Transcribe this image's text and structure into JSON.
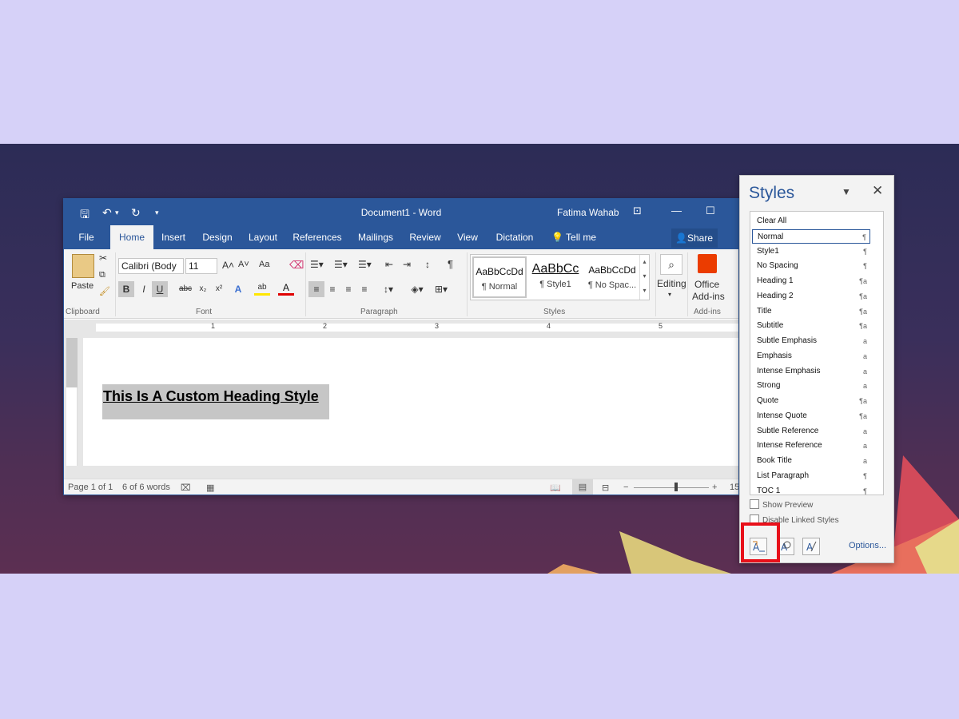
{
  "colors": {
    "accent": "#2b579a",
    "highlight_red": "#e8101a"
  },
  "word": {
    "title_doc": "Document1",
    "title_sep": "-",
    "title_app": "Word",
    "user": "Fatima Wahab",
    "tabs": [
      "File",
      "Home",
      "Insert",
      "Design",
      "Layout",
      "References",
      "Mailings",
      "Review",
      "View",
      "Dictation"
    ],
    "tell_me": "Tell me",
    "share": "Share",
    "ribbon": {
      "paste": "Paste",
      "font_name": "Calibri (Body",
      "font_size": "11",
      "aa": "Aa",
      "bold": "B",
      "italic": "I",
      "underline": "U",
      "strike": "abc",
      "sub": "x₂",
      "sup": "x²",
      "pilcrow": "¶",
      "style_samples": [
        "AaBbCcDd",
        "AaBbCc",
        "AaBbCcDd"
      ],
      "style_names": [
        "¶ Normal",
        "¶ Style1",
        "¶ No Spac..."
      ],
      "editing": "Editing",
      "office": "Office",
      "addins": "Add-ins",
      "groups": [
        "Clipboard",
        "Font",
        "Paragraph",
        "Styles",
        "Add-ins"
      ]
    },
    "ruler_numbers": [
      "1",
      "2",
      "3",
      "4",
      "5"
    ],
    "document_text": "This Is A Custom Heading Style",
    "status": {
      "page": "Page 1 of 1",
      "words": "6 of 6 words",
      "zoom_minus": "−",
      "zoom_plus": "+",
      "zoom": "15"
    }
  },
  "styles_pane": {
    "title": "Styles",
    "items": [
      {
        "name": "Clear All",
        "mark": ""
      },
      {
        "name": "Normal",
        "mark": "¶"
      },
      {
        "name": "Style1",
        "mark": "¶"
      },
      {
        "name": "No Spacing",
        "mark": "¶"
      },
      {
        "name": "Heading 1",
        "mark": "¶a"
      },
      {
        "name": "Heading 2",
        "mark": "¶a"
      },
      {
        "name": "Title",
        "mark": "¶a"
      },
      {
        "name": "Subtitle",
        "mark": "¶a"
      },
      {
        "name": "Subtle Emphasis",
        "mark": "a"
      },
      {
        "name": "Emphasis",
        "mark": "a"
      },
      {
        "name": "Intense Emphasis",
        "mark": "a"
      },
      {
        "name": "Strong",
        "mark": "a"
      },
      {
        "name": "Quote",
        "mark": "¶a"
      },
      {
        "name": "Intense Quote",
        "mark": "¶a"
      },
      {
        "name": "Subtle Reference",
        "mark": "a"
      },
      {
        "name": "Intense Reference",
        "mark": "a"
      },
      {
        "name": "Book Title",
        "mark": "a"
      },
      {
        "name": "List Paragraph",
        "mark": "¶"
      },
      {
        "name": "TOC 1",
        "mark": "¶"
      }
    ],
    "selected": "Normal",
    "show_preview": "Show Preview",
    "disable_linked": "Disable Linked Styles",
    "options": "Options..."
  }
}
